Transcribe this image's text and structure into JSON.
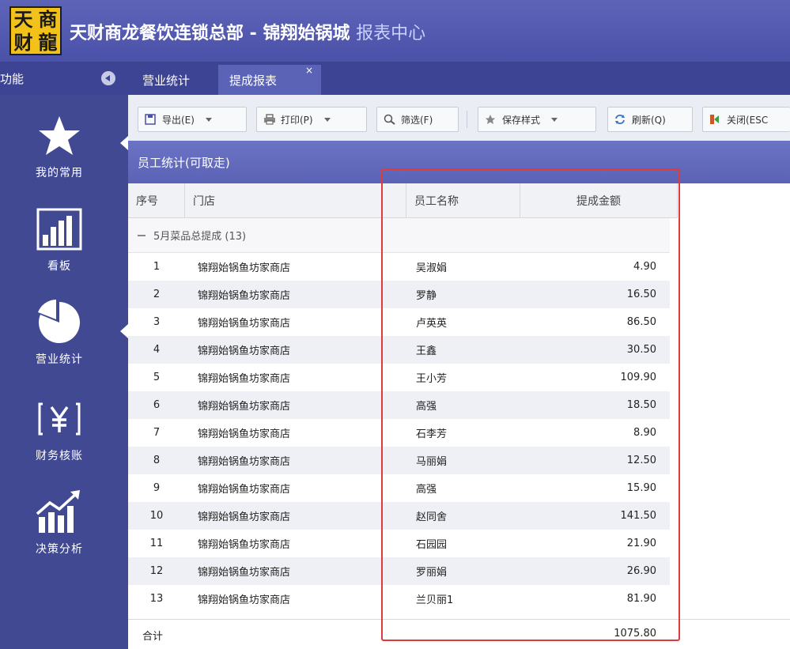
{
  "app": {
    "logo_chars": [
      "天",
      "商",
      "财",
      "龍"
    ],
    "title": "天财商龙餐饮连锁总部 - 锦翔始锅城",
    "subtitle": "报表中心"
  },
  "tabbar": {
    "sidebar_label": "功能",
    "tabs": [
      {
        "label": "营业统计"
      },
      {
        "label": "提成报表"
      }
    ],
    "close_glyph": "×"
  },
  "sidebar": {
    "items": [
      {
        "label": "我的常用",
        "icon": "star-icon"
      },
      {
        "label": "看板",
        "icon": "bar-chart-icon"
      },
      {
        "label": "营业统计",
        "icon": "pie-chart-icon"
      },
      {
        "label": "财务核账",
        "icon": "yen-icon"
      },
      {
        "label": "决策分析",
        "icon": "trend-chart-icon"
      }
    ]
  },
  "toolbar": {
    "export": "导出(E)",
    "print": "打印(P)",
    "filter": "筛选(F)",
    "save_style": "保存样式",
    "refresh": "刷新(Q)",
    "close": "关闭(ESC"
  },
  "panel": {
    "title": "员工统计(可取走)"
  },
  "table": {
    "columns": [
      "序号",
      "门店",
      "员工名称",
      "提成金额"
    ],
    "group_label": "5月菜品总提成 (13)",
    "rows": [
      {
        "no": "1",
        "store": "锦翔始锅鱼坊家商店",
        "name": "吴淑娟",
        "amount": "4.90"
      },
      {
        "no": "2",
        "store": "锦翔始锅鱼坊家商店",
        "name": "罗静",
        "amount": "16.50"
      },
      {
        "no": "3",
        "store": "锦翔始锅鱼坊家商店",
        "name": "卢英英",
        "amount": "86.50"
      },
      {
        "no": "4",
        "store": "锦翔始锅鱼坊家商店",
        "name": "王鑫",
        "amount": "30.50"
      },
      {
        "no": "5",
        "store": "锦翔始锅鱼坊家商店",
        "name": "王小芳",
        "amount": "109.90"
      },
      {
        "no": "6",
        "store": "锦翔始锅鱼坊家商店",
        "name": "高强",
        "amount": "18.50"
      },
      {
        "no": "7",
        "store": "锦翔始锅鱼坊家商店",
        "name": "石李芳",
        "amount": "8.90"
      },
      {
        "no": "8",
        "store": "锦翔始锅鱼坊家商店",
        "name": "马丽娟",
        "amount": "12.50"
      },
      {
        "no": "9",
        "store": "锦翔始锅鱼坊家商店",
        "name": "高强",
        "amount": "15.90"
      },
      {
        "no": "10",
        "store": "锦翔始锅鱼坊家商店",
        "name": "赵同舍",
        "amount": "141.50"
      },
      {
        "no": "11",
        "store": "锦翔始锅鱼坊家商店",
        "name": "石园园",
        "amount": "21.90"
      },
      {
        "no": "12",
        "store": "锦翔始锅鱼坊家商店",
        "name": "罗丽娟",
        "amount": "26.90"
      },
      {
        "no": "13",
        "store": "锦翔始锅鱼坊家商店",
        "name": "兰贝丽1",
        "amount": "81.90"
      }
    ],
    "summary_label": "合计",
    "summary_total": "1075.80"
  },
  "colors": {
    "titlebar": "#4a51a8",
    "sidebar": "#414992",
    "panel_header": "#5c63b6",
    "highlight": "#e03a3a",
    "logo": "#f2c21a"
  }
}
